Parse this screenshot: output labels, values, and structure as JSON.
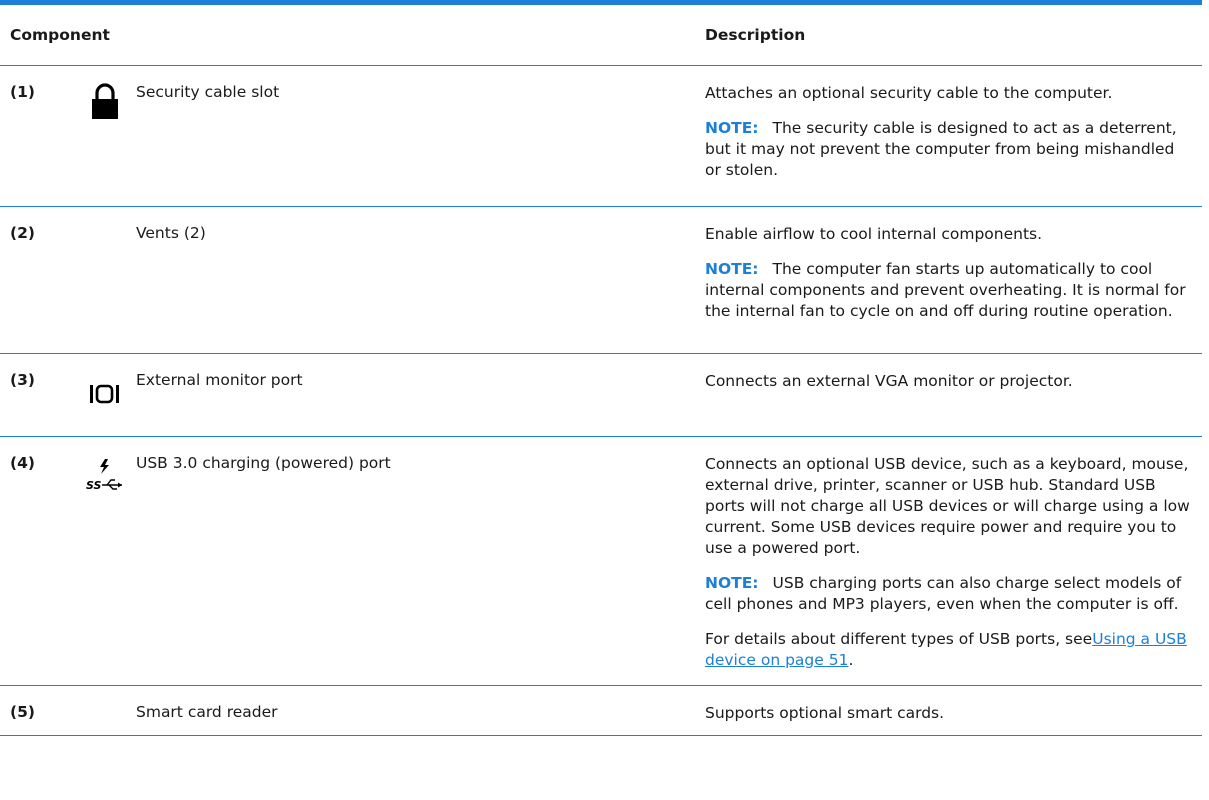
{
  "header": {
    "component": "Component",
    "description": "Description"
  },
  "rows": [
    {
      "number": "(1)",
      "icon": "lock-icon",
      "name": "Security cable slot",
      "desc": "Attaches an optional security cable to the computer.",
      "note_label": "NOTE:",
      "note": "The security cable is designed to act as a deterrent, but it may not prevent the computer from being mishandled or stolen."
    },
    {
      "number": "(2)",
      "icon": "",
      "name": "Vents (2)",
      "desc": "Enable airflow to cool internal components.",
      "note_label": "NOTE:",
      "note": "The computer fan starts up automatically to cool internal components and prevent overheating. It is normal for the internal fan to cycle on and off during routine operation."
    },
    {
      "number": "(3)",
      "icon": "external-monitor-port-icon",
      "name": "External monitor port",
      "desc": "Connects an external VGA monitor or projector."
    },
    {
      "number": "(4)",
      "icon": "usb-charging-ss-icon",
      "name": "USB 3.0 charging (powered) port",
      "desc": "Connects an optional USB device, such as a keyboard, mouse, external drive, printer, scanner or USB hub. Standard USB ports will not charge all USB devices or will charge using a low current. Some USB devices require power and require you to use a powered port.",
      "note_label": "NOTE:",
      "note": "USB charging ports can also charge select models of cell phones and MP3 players, even when the computer is off.",
      "details_prefix": "For details about different types of USB ports, see",
      "details_link": "Using a USB device on page 51",
      "details_suffix": "."
    },
    {
      "number": "(5)",
      "icon": "",
      "name": "Smart card reader",
      "desc": "Supports optional smart cards."
    }
  ],
  "colors": {
    "accent": "#1d7fd6",
    "text": "#1a1a1a"
  }
}
